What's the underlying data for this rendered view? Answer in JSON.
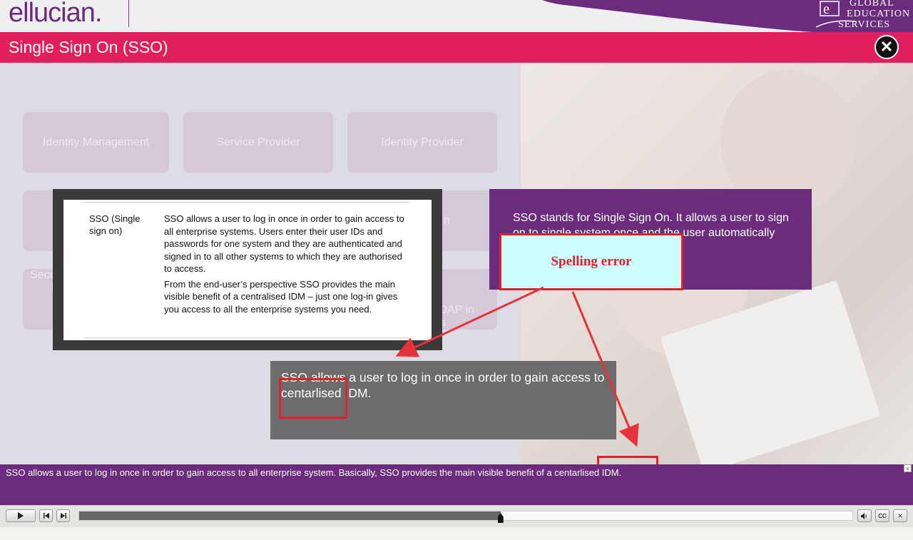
{
  "header": {
    "logo": "ellucian.",
    "brand_lines": [
      "GLOBAL",
      "EDUCATION",
      "SERVICES"
    ],
    "brand_mark": "e"
  },
  "titlebar": {
    "title": "Single Sign On (SSO)",
    "close_icon": "close-icon"
  },
  "tiles": {
    "identity_management": "Identity Management",
    "service_provider": "Service Provider",
    "identity_provider": "Identity Provider",
    "hidden_1": "h",
    "hidden_2": "Secu",
    "hidden_3": "I",
    "hidden_4": "DAP in",
    "hidden_5": "s"
  },
  "document": {
    "term": "SSO (Single sign on)",
    "para1": "SSO allows a user to log in once in order to gain access to all enterprise systems. Users enter their user IDs and passwords for one system and they are authenticated and signed in to all other systems to which they are authorised to access.",
    "para2": "From the end-user’s perspective SSO provides the main visible benefit of a centralised IDM – just one log-in gives you access to all the enterprise systems you need."
  },
  "purple_panel": {
    "text": "SSO stands for Single Sign On. It allows a user to sign on to single system once and the user automatically which they are"
  },
  "annotation": {
    "label": "Spelling error"
  },
  "text_panel": {
    "line1": "SSO allows a user to log in once in order to gain access to",
    "line2": "centarlised IDM."
  },
  "caption": {
    "text": "SSO allows a user to log in once in order to gain access to all enterprise system. Basically, SSO provides the main visible benefit of a centarlised IDM.",
    "close_label": "×"
  },
  "player": {
    "play_icon": "play-icon",
    "prev_icon": "previous-icon",
    "next_icon": "next-icon",
    "volume_icon": "volume-icon",
    "cc_label": "CC",
    "exit_label": "×",
    "progress": 0.545
  },
  "colors": {
    "purple": "#6b2c7e",
    "pink": "#e01f5c",
    "annotation_red": "#e02128",
    "annotation_fill": "#ccfeff"
  }
}
